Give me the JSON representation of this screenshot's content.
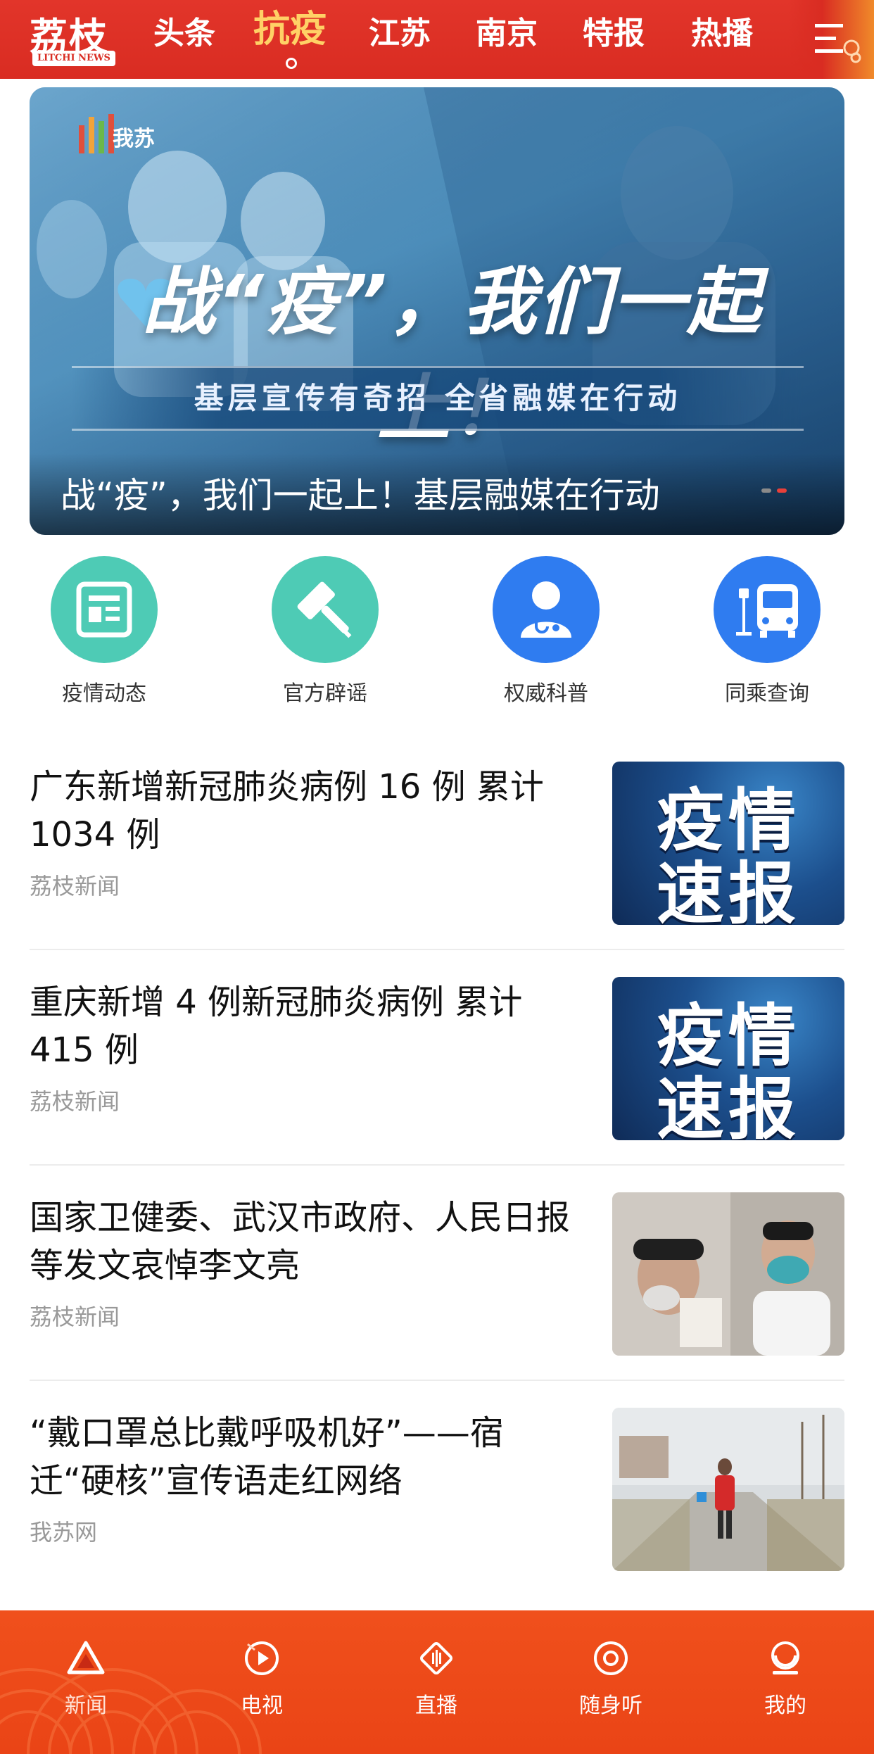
{
  "colors": {
    "brand_red": "#d92c22",
    "active_tab": "#ffd166",
    "tabbar_orange": "#ea4416",
    "teal": "#4ecbb5",
    "blue": "#2f7cf0"
  },
  "header": {
    "logo_main": "荔枝",
    "logo_sub": "LITCHI NEWS",
    "tabs": [
      {
        "label": "头条"
      },
      {
        "label": "抗疫",
        "active": true
      },
      {
        "label": "江苏"
      },
      {
        "label": "南京"
      },
      {
        "label": "特报"
      },
      {
        "label": "热播"
      }
    ],
    "menu_icon": "menu-icon"
  },
  "banner": {
    "brand": "我苏",
    "headline": "战“疫”，我们一起上！",
    "strip": "基层宣传有奇招   全省融媒在行动",
    "caption": "战“疫”，我们一起上！基层融媒在行动",
    "slide_count": 2,
    "active_slide": 2
  },
  "quick_links": [
    {
      "label": "疫情动态",
      "icon": "newspaper-icon"
    },
    {
      "label": "官方辟谣",
      "icon": "gavel-icon"
    },
    {
      "label": "权威科普",
      "icon": "doctor-icon"
    },
    {
      "label": "同乘查询",
      "icon": "bus-icon"
    }
  ],
  "news": [
    {
      "title": "广东新增新冠肺炎病例 16 例 累计1034 例",
      "source": "荔枝新闻",
      "thumb_text": [
        "疫情",
        "速报"
      ]
    },
    {
      "title": " 重庆新增 4 例新冠肺炎病例 累计415 例",
      "source": "荔枝新闻",
      "thumb_text": [
        "疫情",
        "速报"
      ]
    },
    {
      "title": "国家卫健委、武汉市政府、人民日报等发文哀悼李文亮",
      "source": "荔枝新闻"
    },
    {
      "title": "“戴口罩总比戴呼吸机好”——宿迁“硬核”宣传语走红网络",
      "source": "我苏网"
    }
  ],
  "tabbar": [
    {
      "label": "新闻",
      "icon": "news-triangle-icon",
      "active": true
    },
    {
      "label": "电视",
      "icon": "tv-play-icon"
    },
    {
      "label": "直播",
      "icon": "live-icon"
    },
    {
      "label": "随身听",
      "icon": "radio-icon"
    },
    {
      "label": "我的",
      "icon": "profile-icon"
    }
  ]
}
